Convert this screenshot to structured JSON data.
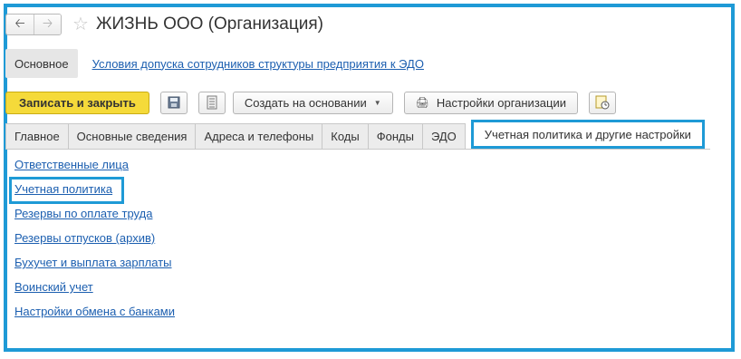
{
  "window": {
    "title": "ЖИЗНЬ ООО (Организация)"
  },
  "sections": {
    "main_label": "Основное",
    "link_label": "Условия допуска сотрудников структуры предприятия к ЭДО"
  },
  "toolbar": {
    "save_close_label": "Записать и закрыть",
    "create_based_label": "Создать на основании",
    "org_settings_label": "Настройки организации"
  },
  "tabs": [
    {
      "label": "Главное"
    },
    {
      "label": "Основные сведения"
    },
    {
      "label": "Адреса и телефоны"
    },
    {
      "label": "Коды"
    },
    {
      "label": "Фонды"
    },
    {
      "label": "ЭДО"
    },
    {
      "label": "Учетная политика и другие настройки",
      "active": true
    }
  ],
  "links": [
    {
      "label": "Ответственные лица"
    },
    {
      "label": "Учетная политика"
    },
    {
      "label": "Резервы по оплате труда"
    },
    {
      "label": "Резервы отпусков (архив)"
    },
    {
      "label": "Бухучет и выплата зарплаты"
    },
    {
      "label": "Воинский учет"
    },
    {
      "label": "Настройки обмена с банками"
    }
  ],
  "colors": {
    "highlight": "#1e9ad6",
    "primary_button": "#f5da3a",
    "link": "#1c5fb0"
  }
}
